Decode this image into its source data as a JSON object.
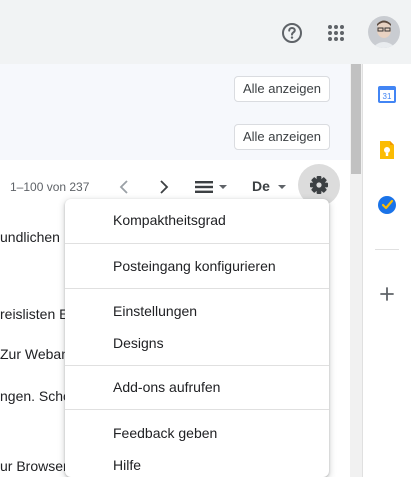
{
  "topbar": {
    "icons": [
      "help-icon",
      "apps-icon"
    ],
    "avatar": "account-avatar"
  },
  "banners": [
    {
      "button_label": "Alle anzeigen"
    },
    {
      "button_label": "Alle anzeigen"
    }
  ],
  "toolbar": {
    "pagination": "1–100 von 237",
    "input_tool": "De",
    "icons": [
      "chevron-left-icon",
      "chevron-right-icon",
      "density-icon",
      "settings-gear-icon"
    ]
  },
  "rows": [
    {
      "snippet": "undlichen"
    },
    {
      "snippet": "reislisten E"
    },
    {
      "snippet": "Zur Weban"
    },
    {
      "snippet": "ngen. Schö"
    },
    {
      "snippet": "ur Browser"
    }
  ],
  "settings_menu": {
    "items": [
      "Kompaktheitsgrad",
      "Posteingang konfigurieren",
      "Einstellungen",
      "Designs",
      "Add-ons aufrufen",
      "Feedback geben",
      "Hilfe"
    ]
  },
  "side_panel": {
    "calendar_day": "31",
    "icons": [
      "calendar-icon",
      "keep-icon",
      "tasks-icon",
      "add-icon"
    ]
  },
  "colors": {
    "topbar_bg": "#f1f3f4",
    "calendar_blue": "#4285f4",
    "keep_yellow": "#fbbc04",
    "tasks_blue": "#1a73e8"
  }
}
